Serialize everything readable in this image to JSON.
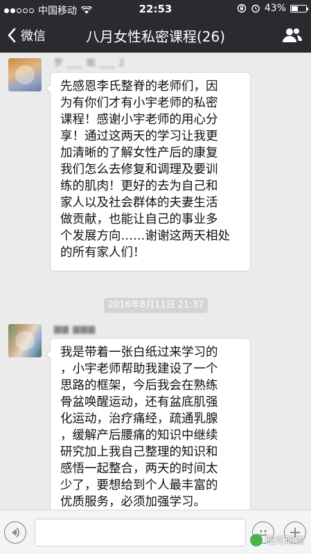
{
  "status_bar": {
    "carrier": "中国移动",
    "time": "22:53",
    "battery": "43%",
    "battery_level": 0.43
  },
  "nav": {
    "back_label": "微信",
    "title": "八月女性私密课程(26)"
  },
  "messages": [
    {
      "sender": "罗 ___ 蜘 ___ 2",
      "text": "先感恩李氏整脊的老师们，因\n为有你们才有小宇老师的私密\n课程！感谢小宇老师的用心分\n享！通过这两天的学习让我更\n加清晰的了解女性产后的康复\n我们怎么去修复和调理及要训\n练的肌肉！更好的去为自己和\n家人以及社会群体的夫妻生活\n做贡献，也能让自己的事业多\n个发展方向……谢谢这两天相处\n的所有家人们！"
    },
    {
      "sender": "▆▆ ▆▆▆",
      "text": "我是带着一张白纸过来学习的\n，小宇老师帮助我建设了一个\n思路的框架，今后我会在熟练\n骨盆唤醒运动，还有盆底肌强\n化运动，治疗痛经，疏通乳腺\n，缓解产后腰痛的知识中继续\n研究加上我自己整理的知识和\n感悟一起整合，两天的时间太\n少了，要想给到个人最丰富的\n优质服务，必须加强学习。"
    }
  ],
  "timestamp": "2016年8月11日 21:37",
  "watermark": "阳光瑜伽",
  "icons": {
    "signal": "signal-dots-icon",
    "wifi": "wifi-icon",
    "lock": "rotation-lock-icon",
    "alarm": "alarm-icon",
    "battery": "battery-icon",
    "back": "chevron-left-icon",
    "contacts": "group-members-icon",
    "voice": "voice-icon",
    "emoji": "emoji-icon",
    "plus": "plus-icon"
  }
}
